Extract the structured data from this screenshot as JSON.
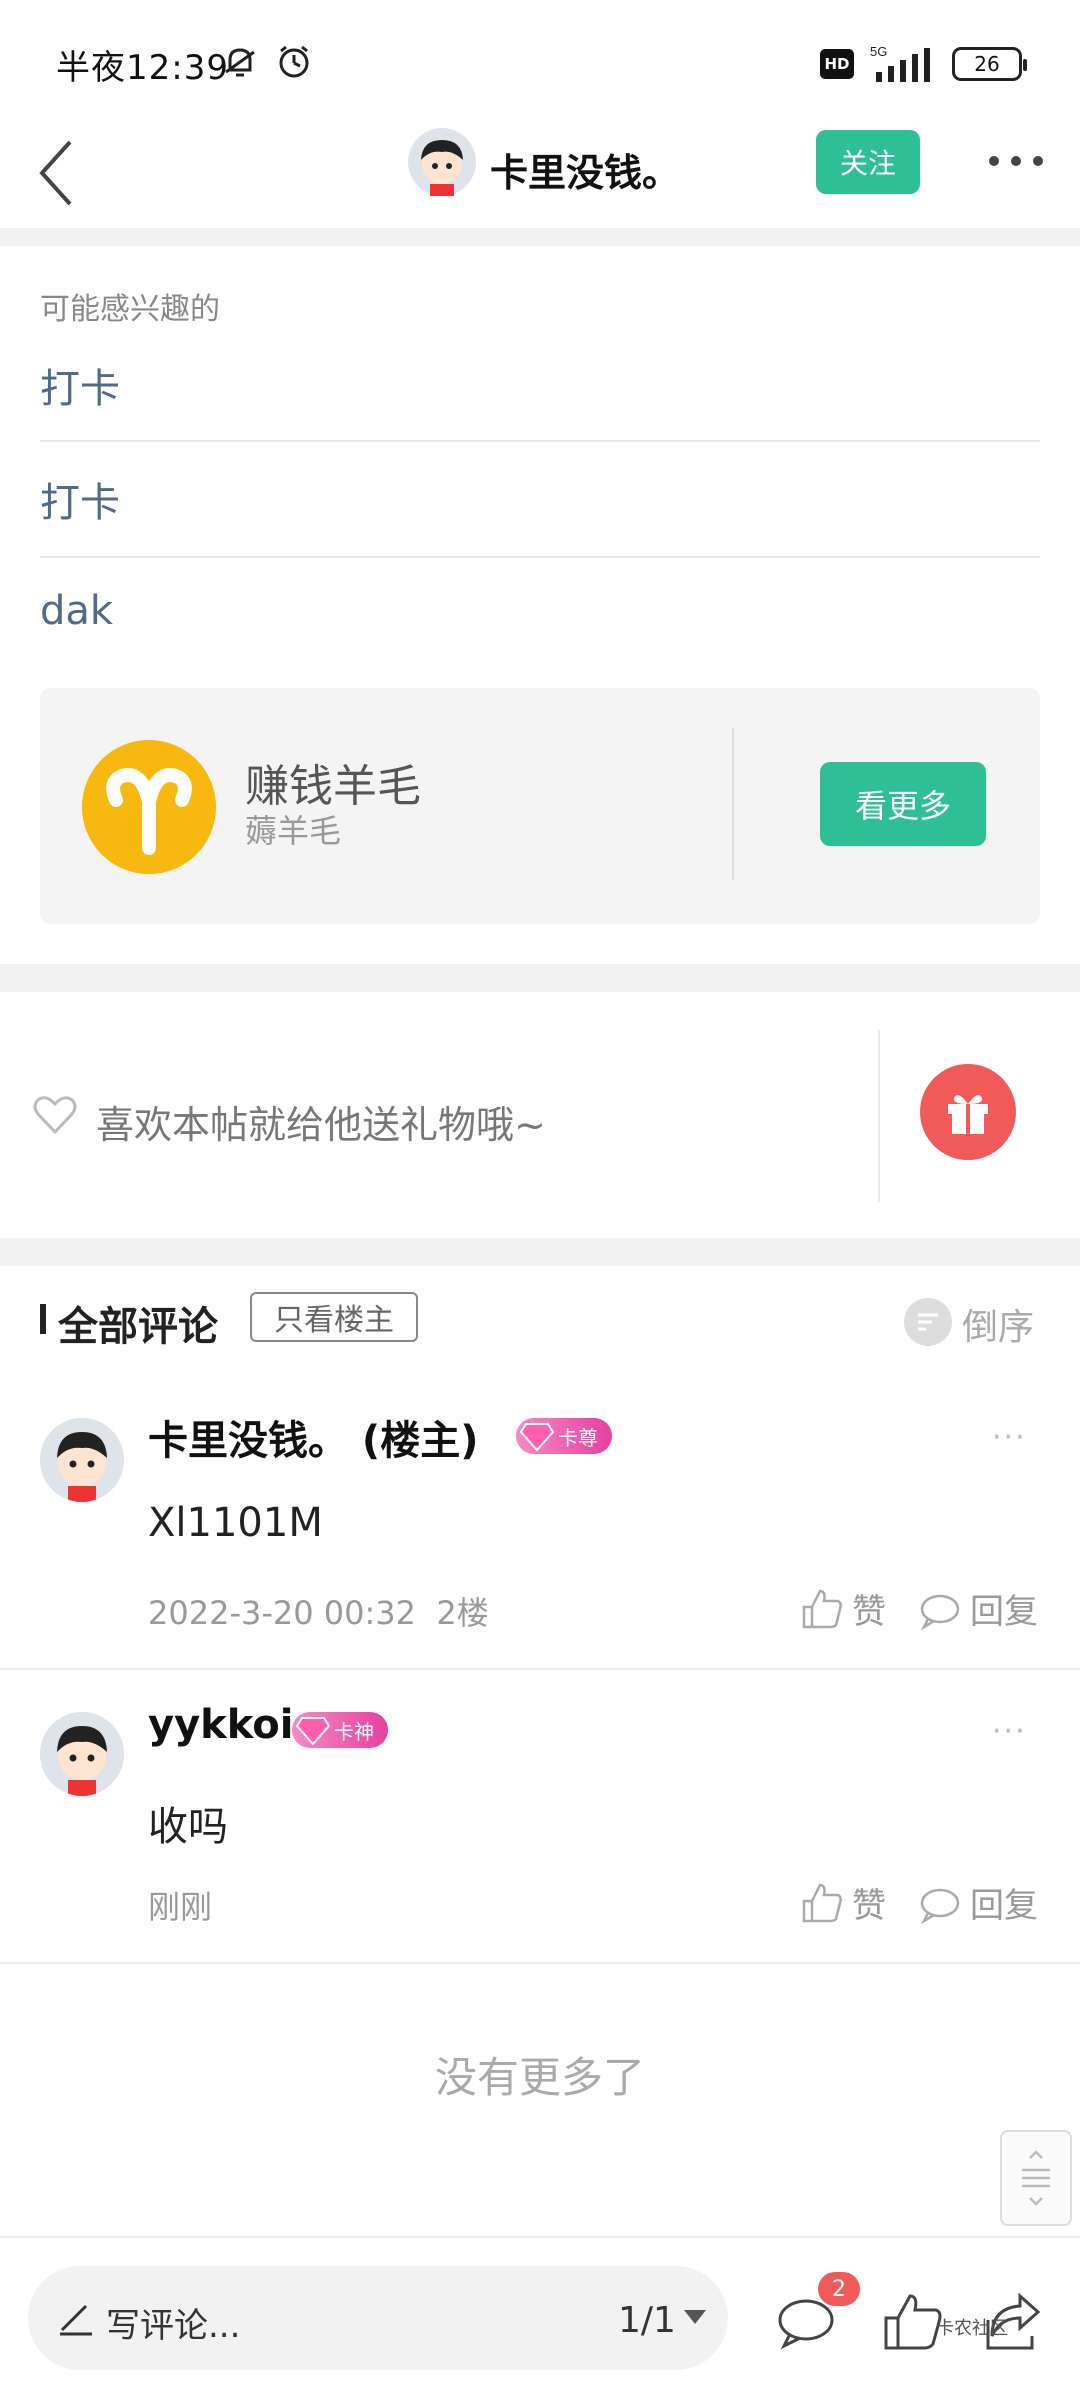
{
  "status_bar": {
    "time": "半夜12:39",
    "network": "5G",
    "battery": "26"
  },
  "nav": {
    "title": "卡里没钱。",
    "follow_label": "关注"
  },
  "interest": {
    "label": "可能感兴趣的",
    "items": [
      "打卡",
      "打卡",
      "dak"
    ]
  },
  "group": {
    "name": "赚钱羊毛",
    "sub": "薅羊毛",
    "more_label": "看更多"
  },
  "gift": {
    "text": "喜欢本帖就给他送礼物哦~"
  },
  "comments_header": {
    "title": "全部评论",
    "only_op": "只看楼主",
    "order": "倒序"
  },
  "comments": [
    {
      "name": "卡里没钱。 (楼主)",
      "badge": "卡尊",
      "body": "Xl1101M",
      "time": "2022-3-20 00:32",
      "floor": "2楼",
      "like": "赞",
      "reply": "回复"
    },
    {
      "name": "yykkoi",
      "badge": "卡神",
      "body": "收吗",
      "time": "刚刚",
      "floor": "",
      "like": "赞",
      "reply": "回复"
    }
  ],
  "no_more": "没有更多了",
  "bottom": {
    "write_placeholder": "写评论...",
    "page_indicator": "1/1",
    "message_count": "2",
    "watermark": "卡农社区"
  },
  "colors": {
    "accent": "#2ebf96",
    "link": "#516a8c",
    "gift": "#f25a5a"
  }
}
